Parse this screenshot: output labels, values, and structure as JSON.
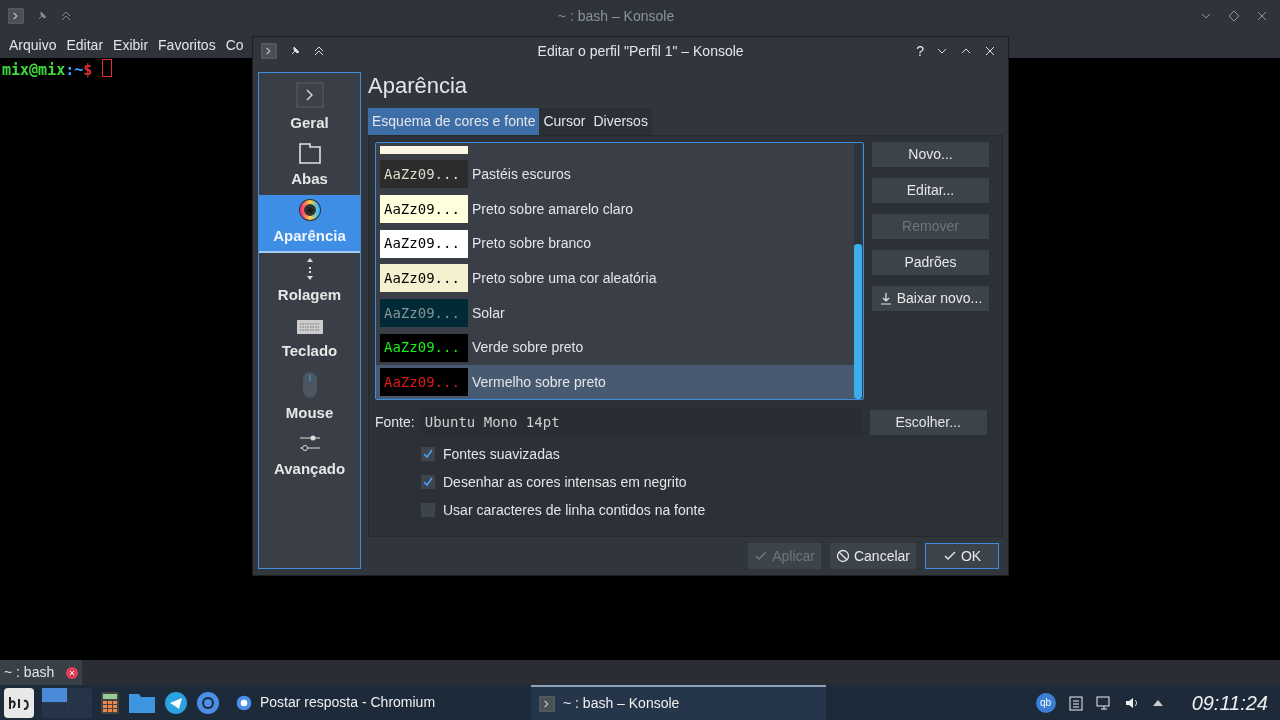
{
  "konsole": {
    "title": "~ : bash – Konsole",
    "menu": [
      "Arquivo",
      "Editar",
      "Exibir",
      "Favoritos",
      "Co"
    ],
    "prompt": {
      "user": "mix@mix",
      "sep": ":",
      "path": "~",
      "symbol": "$"
    },
    "tabs": [
      {
        "label": "~ : bash",
        "selected": true
      }
    ]
  },
  "dialog": {
    "title": "Editar o perfil \"Perfil 1\" – Konsole",
    "title_buttons": [
      "?"
    ],
    "sidebar": [
      {
        "label": "Geral",
        "kind": "terminal",
        "selected": false
      },
      {
        "label": "Abas",
        "kind": "tabs",
        "selected": false
      },
      {
        "label": "Aparência",
        "kind": "palette",
        "selected": true
      },
      {
        "label": "Rolagem",
        "kind": "scroll",
        "selected": false
      },
      {
        "label": "Teclado",
        "kind": "keyboard",
        "selected": false
      },
      {
        "label": "Mouse",
        "kind": "mouse",
        "selected": false
      },
      {
        "label": "Avançado",
        "kind": "sliders",
        "selected": false
      }
    ],
    "heading": "Aparência",
    "tabs": [
      {
        "label": "Esquema de cores e fonte",
        "selected": true
      },
      {
        "label": "Cursor",
        "selected": false
      },
      {
        "label": "Diversos",
        "selected": false
      }
    ],
    "schemes": [
      {
        "preview": {
          "text": "AaZz09...",
          "color": "#dcdccc"
        },
        "name": "Pastéis escuros",
        "color": "#2c2c2c",
        "selected": false
      },
      {
        "preview": {
          "text": "AaZz09...",
          "color": "#000000"
        },
        "name": "Preto sobre amarelo claro",
        "color": "#ffffdd",
        "selected": false
      },
      {
        "preview": {
          "text": "AaZz09...",
          "color": "#000000"
        },
        "name": "Preto sobre branco",
        "color": "#ffffff",
        "selected": false
      },
      {
        "preview": {
          "text": "AaZz09...",
          "color": "#000000"
        },
        "name": "Preto sobre uma cor aleatória",
        "color": "#f5f0d0",
        "selected": false
      },
      {
        "preview": {
          "text": "AaZz09...",
          "color": "#839496"
        },
        "name": "Solar",
        "color": "#002b36",
        "selected": false
      },
      {
        "preview": {
          "text": "AaZz09...",
          "color": "#18f018"
        },
        "name": "Verde sobre preto",
        "color": "#000000",
        "selected": false
      },
      {
        "preview": {
          "text": "AaZz09...",
          "color": "#e01818"
        },
        "name": "Vermelho sobre preto",
        "color": "#000000",
        "selected": true
      }
    ],
    "scheme_buttons": [
      {
        "label": "Novo...",
        "disabled": false,
        "kind": "plain"
      },
      {
        "label": "Editar...",
        "disabled": false,
        "kind": "plain"
      },
      {
        "label": "Remover",
        "disabled": true,
        "kind": "plain"
      },
      {
        "label": "Padrões",
        "disabled": false,
        "kind": "plain"
      },
      {
        "label": "Baixar novo...",
        "disabled": false,
        "kind": "download"
      }
    ],
    "font_label": "Fonte:",
    "font_value": "Ubuntu Mono 14pt",
    "choose_button": "Escolher...",
    "options": [
      {
        "label": "Fontes suavizadas",
        "checked": true
      },
      {
        "label": "Desenhar as cores intensas em negrito",
        "checked": true
      },
      {
        "label": "Usar caracteres de linha contidos na fonte",
        "checked": false
      }
    ],
    "buttons": [
      {
        "label": "Aplicar",
        "kind": "check",
        "disabled": true,
        "default": false
      },
      {
        "label": "Cancelar",
        "kind": "cancel",
        "disabled": false,
        "default": false
      },
      {
        "label": "OK",
        "kind": "check",
        "disabled": false,
        "default": true
      }
    ]
  },
  "taskbar": {
    "tasks": [
      {
        "label": "Postar resposta - Chromium",
        "kind": "browser",
        "selected": false
      },
      {
        "label": "~ : bash – Konsole",
        "kind": "terminal",
        "selected": true
      }
    ],
    "clock": "09:11:24",
    "tray_badge": "qb"
  }
}
